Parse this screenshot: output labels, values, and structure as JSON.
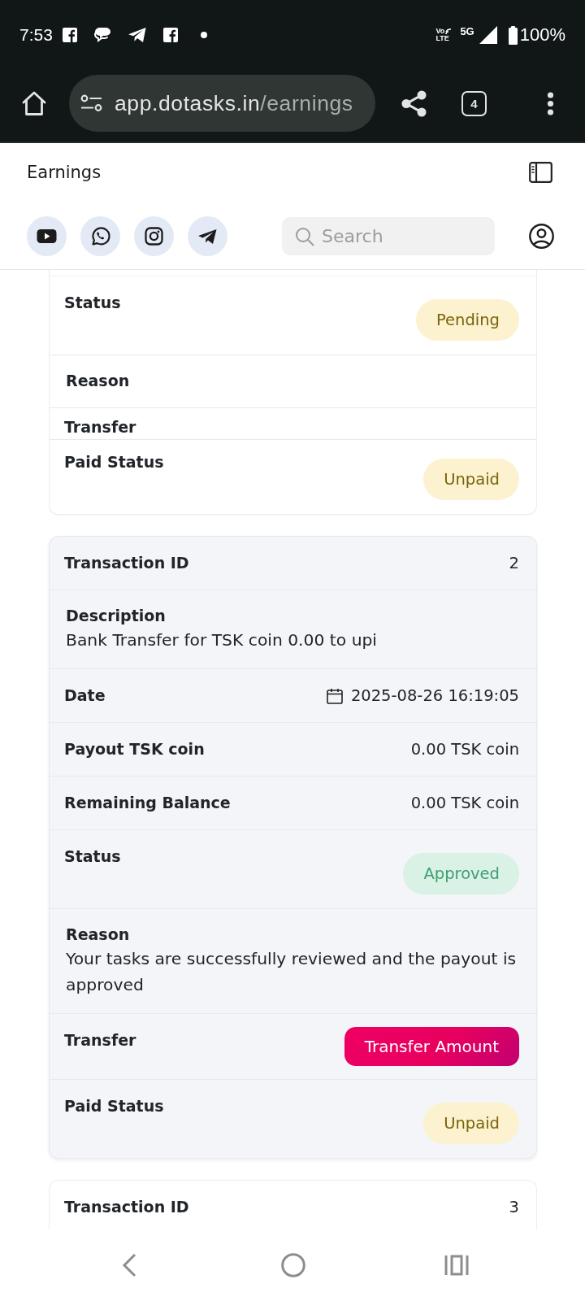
{
  "status_bar": {
    "time": "7:53",
    "volte": [
      "Vo",
      "LTE"
    ],
    "network": "5G",
    "battery": "100%"
  },
  "browser": {
    "url_host": "app.dotasks.in",
    "url_path": "/earnings",
    "tab_count": "4"
  },
  "header": {
    "title": "Earnings",
    "search": {
      "placeholder": "Search"
    }
  },
  "cards": [
    {
      "highlighted": false,
      "rows": [
        {
          "kind": "badge",
          "label": "Status",
          "value": "Pending",
          "color": "#7b6309"
        },
        {
          "kind": "text",
          "label": "Reason"
        },
        {
          "kind": "plain",
          "label": "Transfer"
        },
        {
          "kind": "badge",
          "label": "Paid Status",
          "value": "Unpaid",
          "color": "#7b6309"
        }
      ]
    },
    {
      "highlighted": true,
      "rows": [
        {
          "kind": "field",
          "label": "Transaction ID",
          "value": "2"
        },
        {
          "kind": "text",
          "label": "Description",
          "text": "Bank Transfer for TSK coin 0.00 to upi"
        },
        {
          "kind": "date",
          "label": "Date",
          "value": "2025-08-26 16:19:05"
        },
        {
          "kind": "field",
          "label": "Payout TSK coin",
          "value": "0.00 TSK coin"
        },
        {
          "kind": "field",
          "label": "Remaining Balance",
          "value": "0.00 TSK coin"
        },
        {
          "kind": "badge",
          "label": "Status",
          "value": "Approved",
          "color": "#3f9f73"
        },
        {
          "kind": "text",
          "label": "Reason",
          "text": "Your tasks are successfully reviewed and the payout is approved"
        },
        {
          "kind": "button",
          "label": "Transfer",
          "value": "Transfer Amount"
        },
        {
          "kind": "badge",
          "label": "Paid Status",
          "value": "Unpaid",
          "color": "#7b6309"
        }
      ]
    },
    {
      "highlighted": false,
      "rows": [
        {
          "kind": "field",
          "label": "Transaction ID",
          "value": "3"
        }
      ]
    }
  ]
}
